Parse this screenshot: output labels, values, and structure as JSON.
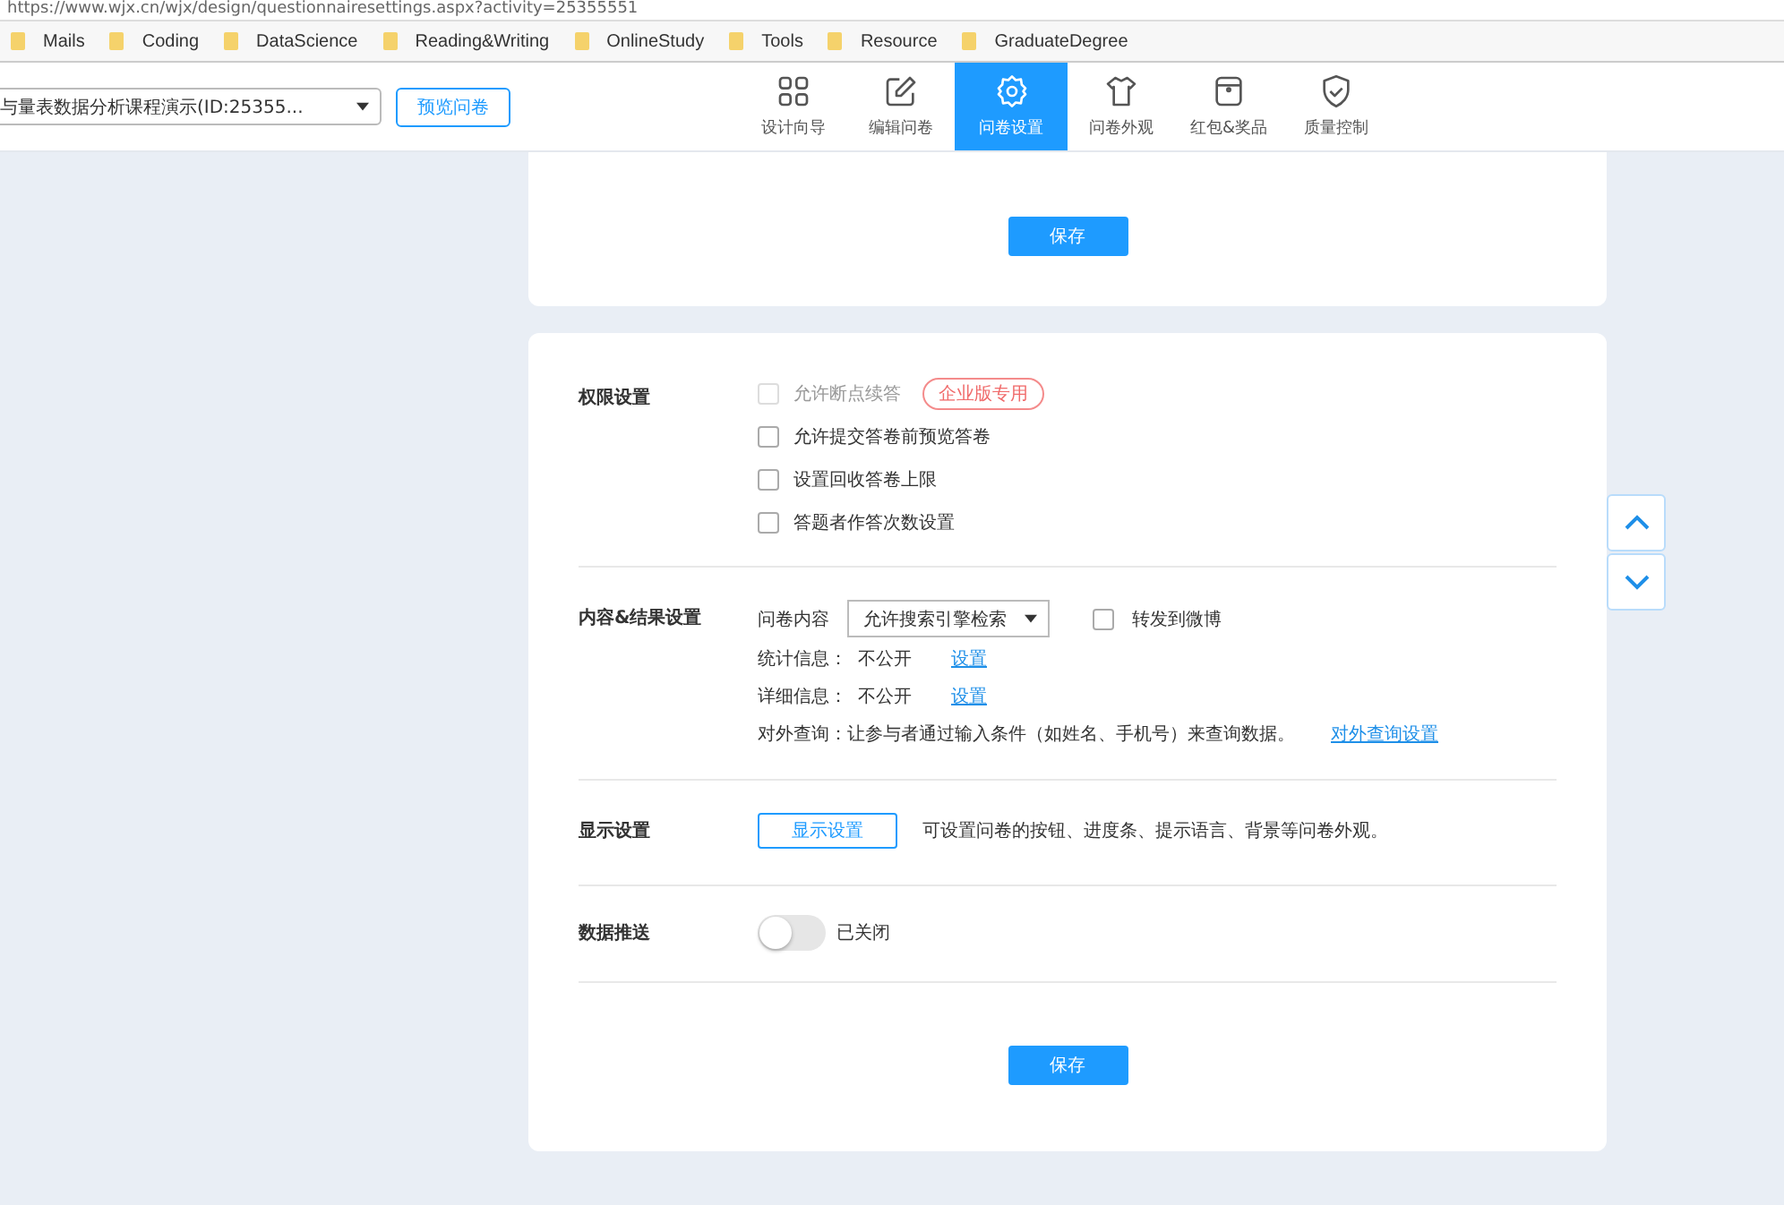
{
  "address_bar": {
    "url": "https://www.wjx.cn/wjx/design/questionnairesettings.aspx?activity=25355551"
  },
  "bookmarks": [
    "Mails",
    "Coding",
    "DataScience",
    "Reading&Writing",
    "OnlineStudy",
    "Tools",
    "Resource",
    "GraduateDegree"
  ],
  "header": {
    "survey_select": "与量表数据分析课程演示(ID:25355...",
    "preview_button": "预览问卷",
    "tabs": [
      {
        "label": "设计向导",
        "selected": false
      },
      {
        "label": "编辑问卷",
        "selected": false
      },
      {
        "label": "问卷设置",
        "selected": true
      },
      {
        "label": "问卷外观",
        "selected": false
      },
      {
        "label": "红包&奖品",
        "selected": false
      },
      {
        "label": "质量控制",
        "selected": false
      }
    ]
  },
  "top_card": {
    "save_button": "保存"
  },
  "sections": [
    {
      "kind": "checkboxes",
      "title": "权限设置",
      "options": [
        {
          "label": "允许断点续答",
          "checked": false,
          "disabled": true,
          "badge": "企业版专用"
        },
        {
          "label": "允许提交答卷前预览答卷",
          "checked": false,
          "disabled": false
        },
        {
          "label": "设置回收答卷上限",
          "checked": false,
          "disabled": false
        },
        {
          "label": "答题者作答次数设置",
          "checked": false,
          "disabled": false
        }
      ]
    },
    {
      "kind": "content",
      "title": "内容&结果设置",
      "content_label": "问卷内容",
      "content_select": "允许搜索引擎检索",
      "share": {
        "label": "转发到微博",
        "checked": false
      },
      "info_rows": [
        {
          "label": "统计信息：",
          "value": "不公开",
          "link": "设置"
        },
        {
          "label": "详细信息：",
          "value": "不公开",
          "link": "设置"
        }
      ],
      "query": {
        "text": "对外查询：让参与者通过输入条件（如姓名、手机号）来查询数据。",
        "link": "对外查询设置"
      }
    },
    {
      "kind": "display",
      "title": "显示设置",
      "button": "显示设置",
      "description": "可设置问卷的按钮、进度条、提示语言、背景等问卷外观。"
    },
    {
      "kind": "toggle",
      "title": "数据推送",
      "on": false,
      "status": "已关闭"
    }
  ],
  "save_button": "保存"
}
